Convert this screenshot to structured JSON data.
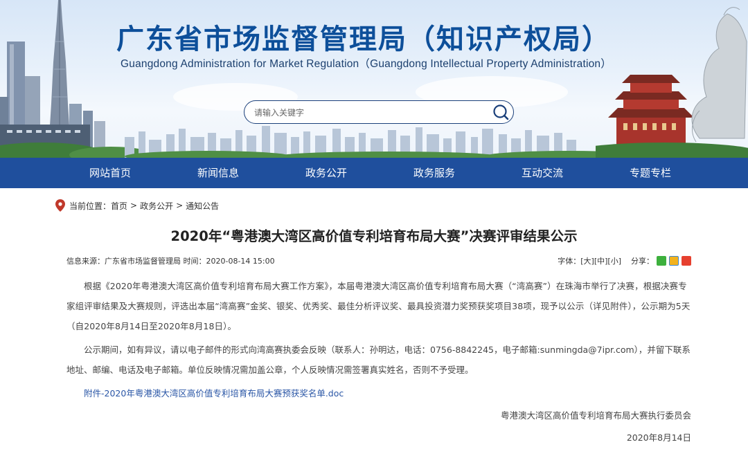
{
  "header": {
    "title_cn": "广东省市场监督管理局（知识产权局）",
    "title_en": "Guangdong Administration for Market Regulation（Guangdong Intellectual Property Administration）"
  },
  "search": {
    "placeholder": "请输入关键字",
    "icon": "search-icon"
  },
  "nav": {
    "items": [
      "网站首页",
      "新闻信息",
      "政务公开",
      "政务服务",
      "互动交流",
      "专题专栏"
    ]
  },
  "breadcrumb": {
    "label": "当前位置：",
    "items": [
      "首页",
      "政务公开",
      "通知公告"
    ],
    "separator": ">"
  },
  "article": {
    "title": "2020年“粤港澳大湾区高价值专利培育布局大赛”决赛评审结果公示",
    "meta": "信息来源：广东省市场监督管理局  时间：2020-08-14 15:00",
    "font_label": "字体：",
    "font_sizes": [
      "[大]",
      "[中]",
      "[小]"
    ],
    "share_label": "分享：",
    "share_icons": [
      "wechat-icon",
      "qzone-icon",
      "weibo-icon"
    ],
    "paragraphs": [
      "根据《2020年粤港澳大湾区高价值专利培育布局大赛工作方案》，本届粤港澳大湾区高价值专利培育布局大赛（“湾高赛”）在珠海市举行了决赛，根据决赛专家组评审结果及大赛规则，评选出本届“湾高赛”金奖、银奖、优秀奖、最佳分析评议奖、最具投资潜力奖预获奖项目38项，现予以公示（详见附件），公示期为5天（自2020年8月14日至2020年8月18日）。",
      "公示期间，如有异议，请以电子邮件的形式向湾高赛执委会反映（联系人：孙明达，电话：0756-8842245，电子邮箱:sunmingda@7ipr.com），并留下联系地址、邮编、电话及电子邮箱。单位反映情况需加盖公章，个人反映情况需签署真实姓名，否则不予受理。"
    ],
    "attachment": "附件-2020年粤港澳大湾区高价值专利培育布局大赛预获奖名单.doc",
    "signature": "粤港澳大湾区高价值专利培育布局大赛执行委员会",
    "date": "2020年8月14日"
  },
  "colors": {
    "nav_bg": "#1f4f9d",
    "title_blue": "#0d4f9a",
    "link_blue": "#2a56a6"
  }
}
